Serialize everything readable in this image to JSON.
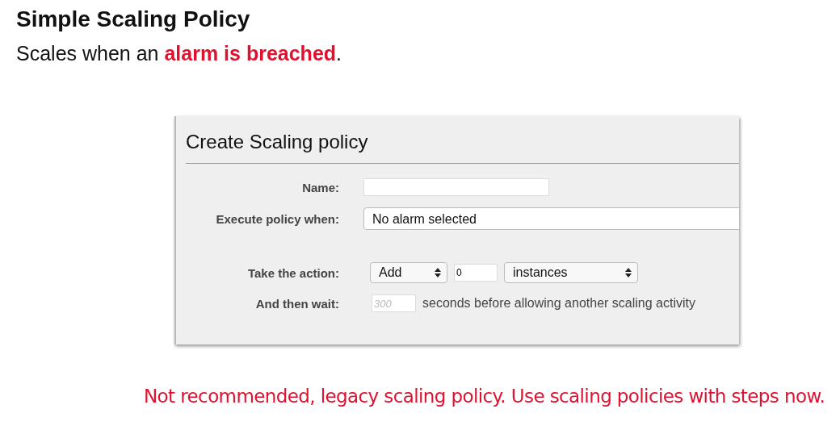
{
  "heading": "Simple Scaling Policy",
  "subheading": "Scales when an **alarm is breached**.",
  "dialog": {
    "title": "Create Scaling policy",
    "fields": [
      {
        "kind": "text",
        "label": "Name:"
      },
      {
        "kind": "select",
        "label": "Execute policy when:",
        "value": "No alarm selected"
      }
    ],
    "action": {
      "label": "Take the action:",
      "operation": "Add",
      "amount": "0",
      "unit": "instances"
    },
    "wait": {
      "label": "And then wait:",
      "placeholder": "300",
      "suffix": "seconds before allowing another scaling activity"
    }
  },
  "note": "Not recommended, legacy scaling policy. Use scaling policies with steps now."
}
